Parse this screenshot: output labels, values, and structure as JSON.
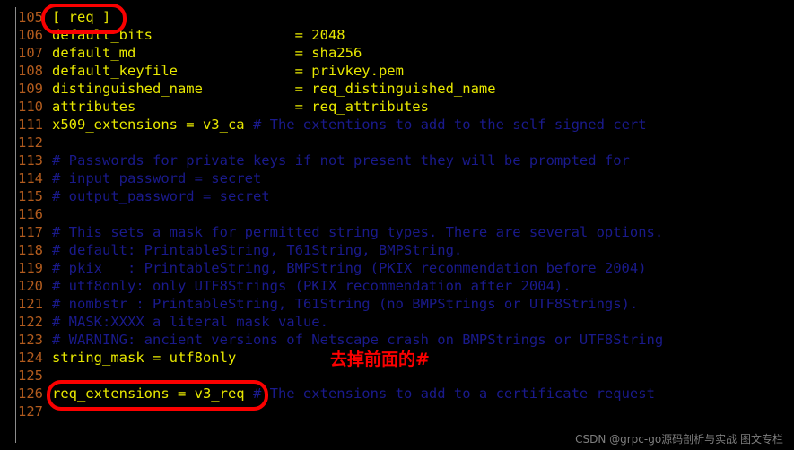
{
  "editor": {
    "background_color": "#000000",
    "gutter_color": "#b35c1e",
    "code_color": "#e8e800",
    "comment_color": "#1a1a8c",
    "annotation_color": "#fa0000",
    "first_line": 105,
    "lines": [
      {
        "number": "105",
        "segments": [
          {
            "text": "[ req ]",
            "kind": "code"
          }
        ]
      },
      {
        "number": "106",
        "segments": [
          {
            "text": "default_bits                 = 2048",
            "kind": "code"
          }
        ]
      },
      {
        "number": "107",
        "segments": [
          {
            "text": "default_md                   = sha256",
            "kind": "code"
          }
        ]
      },
      {
        "number": "108",
        "segments": [
          {
            "text": "default_keyfile              = privkey.pem",
            "kind": "code"
          }
        ]
      },
      {
        "number": "109",
        "segments": [
          {
            "text": "distinguished_name           = req_distinguished_name",
            "kind": "code"
          }
        ]
      },
      {
        "number": "110",
        "segments": [
          {
            "text": "attributes                   = req_attributes",
            "kind": "code"
          }
        ]
      },
      {
        "number": "111",
        "segments": [
          {
            "text": "x509_extensions = v3_ca ",
            "kind": "code"
          },
          {
            "text": "# The extentions to add to the self signed cert",
            "kind": "comment"
          }
        ]
      },
      {
        "number": "112",
        "segments": []
      },
      {
        "number": "113",
        "segments": [
          {
            "text": "# Passwords for private keys if not present they will be prompted for",
            "kind": "comment"
          }
        ]
      },
      {
        "number": "114",
        "segments": [
          {
            "text": "# input_password = secret",
            "kind": "comment"
          }
        ]
      },
      {
        "number": "115",
        "segments": [
          {
            "text": "# output_password = secret",
            "kind": "comment"
          }
        ]
      },
      {
        "number": "116",
        "segments": []
      },
      {
        "number": "117",
        "segments": [
          {
            "text": "# This sets a mask for permitted string types. There are several options.",
            "kind": "comment"
          }
        ]
      },
      {
        "number": "118",
        "segments": [
          {
            "text": "# default: PrintableString, T61String, BMPString.",
            "kind": "comment"
          }
        ]
      },
      {
        "number": "119",
        "segments": [
          {
            "text": "# pkix   : PrintableString, BMPString (PKIX recommendation before 2004)",
            "kind": "comment"
          }
        ]
      },
      {
        "number": "120",
        "segments": [
          {
            "text": "# utf8only: only UTF8Strings (PKIX recommendation after 2004).",
            "kind": "comment"
          }
        ]
      },
      {
        "number": "121",
        "segments": [
          {
            "text": "# nombstr : PrintableString, T61String (no BMPStrings or UTF8Strings).",
            "kind": "comment"
          }
        ]
      },
      {
        "number": "122",
        "segments": [
          {
            "text": "# MASK:XXXX a literal mask value.",
            "kind": "comment"
          }
        ]
      },
      {
        "number": "123",
        "segments": [
          {
            "text": "# WARNING: ancient versions of Netscape crash on BMPStrings or UTF8String",
            "kind": "comment"
          }
        ]
      },
      {
        "number": "124",
        "segments": [
          {
            "text": "string_mask = utf8only",
            "kind": "code"
          }
        ]
      },
      {
        "number": "125",
        "segments": []
      },
      {
        "number": "126",
        "segments": [
          {
            "text": "req_extensions = v3_req ",
            "kind": "code"
          },
          {
            "text": "# The extensions to add to a certificate request",
            "kind": "comment"
          }
        ]
      },
      {
        "number": "127",
        "segments": []
      }
    ]
  },
  "annotations": {
    "highlight_boxes": [
      {
        "id": "req-section-header-box",
        "target_line": "105",
        "target_text": "[ req ]"
      },
      {
        "id": "req-extensions-box",
        "target_line": "126",
        "target_text": "req_extensions = v3_req"
      }
    ],
    "note": {
      "id": "remove-hash-note",
      "text": "去掉前面的#",
      "color": "#fa0000"
    }
  },
  "watermark": {
    "text": "CSDN @grpc-go源码剖析与实战 图文专栏"
  }
}
